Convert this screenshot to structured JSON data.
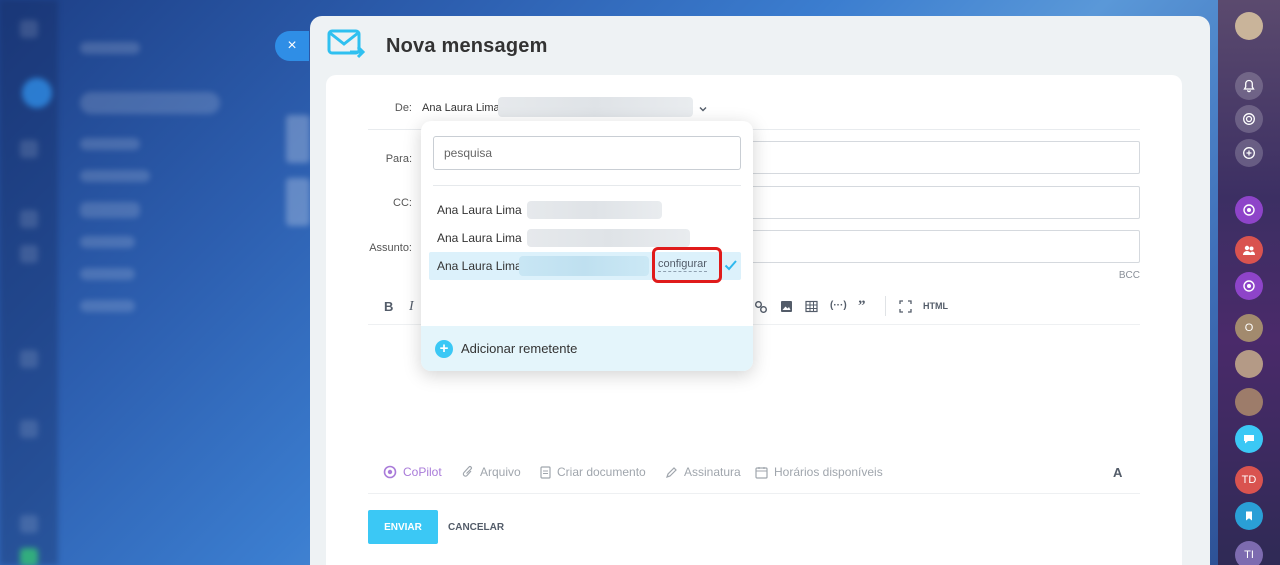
{
  "panel": {
    "title": "Nova mensagem"
  },
  "form": {
    "from_label": "De:",
    "from_value": "Ana Laura Lima",
    "to_label": "Para:",
    "cc_label": "CC:",
    "subject_label": "Assunto:",
    "bcc_label": "BCC"
  },
  "toolbar": {
    "bold": "B",
    "italic": "I",
    "html": "HTML"
  },
  "footer": {
    "copilot": "CoPilot",
    "file": "Arquivo",
    "create_doc": "Criar documento",
    "signature": "Assinatura",
    "available_times": "Horários disponíveis",
    "font": "A"
  },
  "buttons": {
    "send": "ENVIAR",
    "cancel": "CANCELAR"
  },
  "dropdown": {
    "search_placeholder": "pesquisa",
    "items": [
      {
        "name": "Ana Laura Lima"
      },
      {
        "name": "Ana Laura Lima"
      },
      {
        "name": "Ana Laura Lima",
        "selected": true,
        "action": "configurar"
      }
    ],
    "add_sender": "Adicionar remetente"
  },
  "right_rail": {
    "avatar_td": "TD",
    "avatar_ti": "TI",
    "avatar_o": "O"
  },
  "colors": {
    "accent": "#3bc8f5",
    "highlight": "#e01b1b",
    "close_button": "#2f8ee6"
  }
}
